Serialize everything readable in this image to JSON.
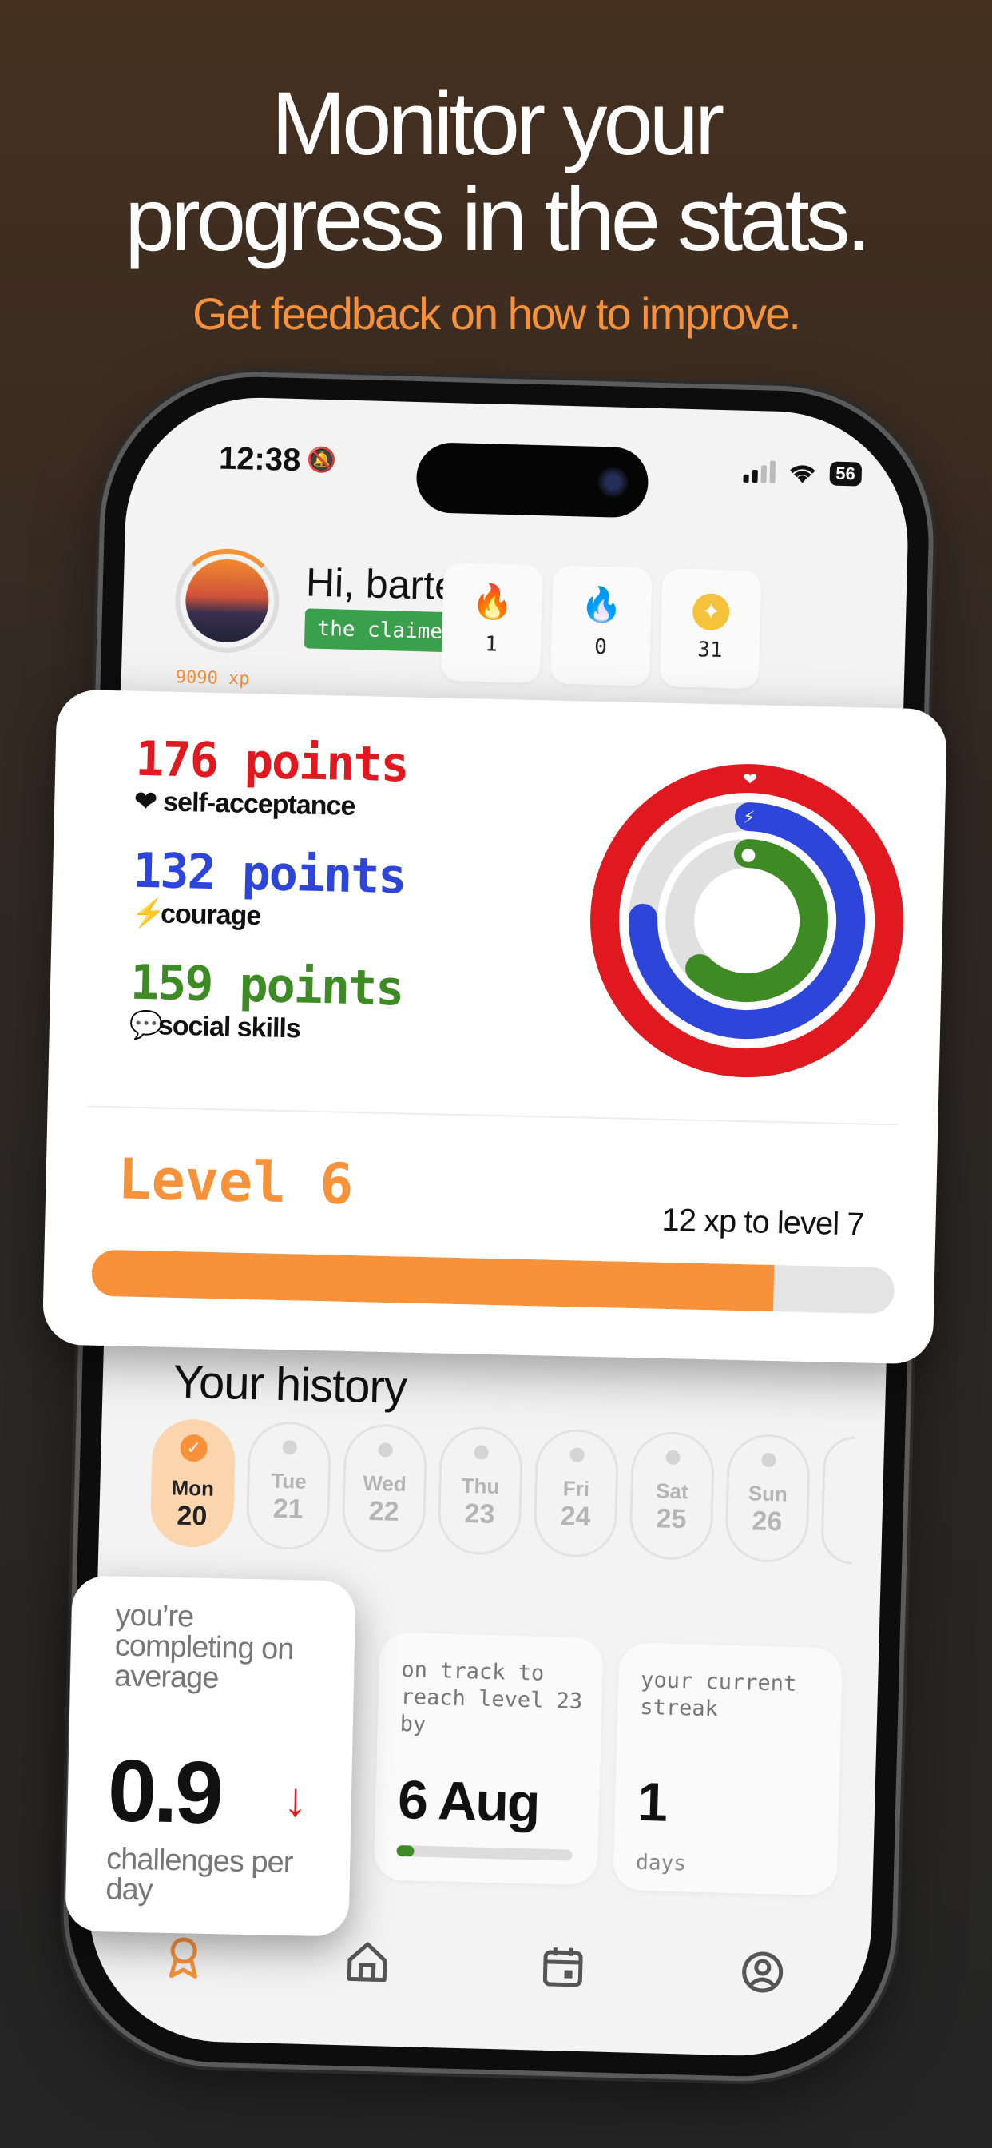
{
  "headline": {
    "line1": "Monitor your",
    "line2": "progress in the stats.",
    "subline": "Get feedback on how to improve."
  },
  "status": {
    "time": "12:38",
    "battery": "56"
  },
  "profile": {
    "greeting": "Hi, bartek1!",
    "badge": "the claimer",
    "xp": "9090 xp",
    "xp_progress": 0.15
  },
  "stats": [
    {
      "icon": "flame-icon",
      "value": "1"
    },
    {
      "icon": "blue-flame-icon",
      "value": "0"
    },
    {
      "icon": "coin-icon",
      "value": "31"
    }
  ],
  "points": [
    {
      "value": "176 points",
      "label": "self-acceptance",
      "icon": "heart-icon",
      "color": "#e0181f"
    },
    {
      "value": "132 points",
      "label": "courage",
      "icon": "bolt-icon",
      "color": "#2d45d8"
    },
    {
      "value": "159 points",
      "label": "social skills",
      "icon": "chat-icon",
      "color": "#3e8b25"
    }
  ],
  "rings": [
    {
      "name": "self-acceptance",
      "fraction": 1.0,
      "color": "#e0181f"
    },
    {
      "name": "courage",
      "fraction": 0.75,
      "color": "#2d45d8"
    },
    {
      "name": "social skills",
      "fraction": 0.62,
      "color": "#3e8b25"
    }
  ],
  "level": {
    "label": "Level 6",
    "to_next": "12 xp to level 7",
    "progress": 0.85
  },
  "history": {
    "title": "Your history",
    "days": [
      {
        "name": "Mon",
        "date": "20",
        "active": true
      },
      {
        "name": "Tue",
        "date": "21",
        "active": false
      },
      {
        "name": "Wed",
        "date": "22",
        "active": false
      },
      {
        "name": "Thu",
        "date": "23",
        "active": false
      },
      {
        "name": "Fri",
        "date": "24",
        "active": false
      },
      {
        "name": "Sat",
        "date": "25",
        "active": false
      },
      {
        "name": "Sun",
        "date": "26",
        "active": false
      }
    ]
  },
  "cards": {
    "average": {
      "title": "you’re completing on average",
      "value": "0.9",
      "unit": "challenges per day"
    },
    "track": {
      "title": "on track to reach level 23 by",
      "value": "6 Aug",
      "progress": 0.1
    },
    "streak": {
      "title": "your current streak",
      "value": "1",
      "unit": "days"
    }
  },
  "colors": {
    "accent": "#f7923a",
    "red": "#e0181f",
    "blue": "#2d45d8",
    "green": "#3e8b25",
    "badge": "#3aa04b"
  }
}
